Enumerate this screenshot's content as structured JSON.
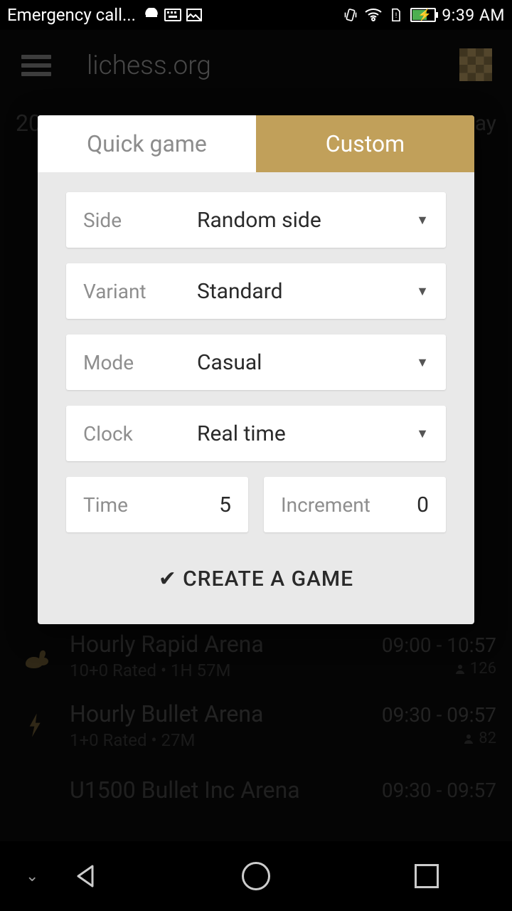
{
  "status": {
    "left_text": "Emergency call...",
    "time": "9:39 AM"
  },
  "header": {
    "title": "lichess.org"
  },
  "bg_preview": {
    "left": "20",
    "right": "ay"
  },
  "modal": {
    "tabs": {
      "quick": "Quick game",
      "custom": "Custom"
    },
    "fields": {
      "side": {
        "label": "Side",
        "value": "Random side"
      },
      "variant": {
        "label": "Variant",
        "value": "Standard"
      },
      "mode": {
        "label": "Mode",
        "value": "Casual"
      },
      "clock": {
        "label": "Clock",
        "value": "Real time"
      },
      "time": {
        "label": "Time",
        "value": "5"
      },
      "increment": {
        "label": "Increment",
        "value": "0"
      }
    },
    "create": "CREATE A GAME"
  },
  "tournaments": [
    {
      "name": "Hourly Rapid Arena",
      "meta": "10+0 Rated • 1H 57M",
      "time": "09:00 - 10:57",
      "players": "126",
      "icon": "rabbit"
    },
    {
      "name": "Hourly Bullet Arena",
      "meta": "1+0 Rated • 27M",
      "time": "09:30 - 09:57",
      "players": "82",
      "icon": "bolt"
    },
    {
      "name": "U1500 Bullet Inc Arena",
      "meta": "",
      "time": "09:30 - 09:57",
      "players": "",
      "icon": ""
    }
  ]
}
